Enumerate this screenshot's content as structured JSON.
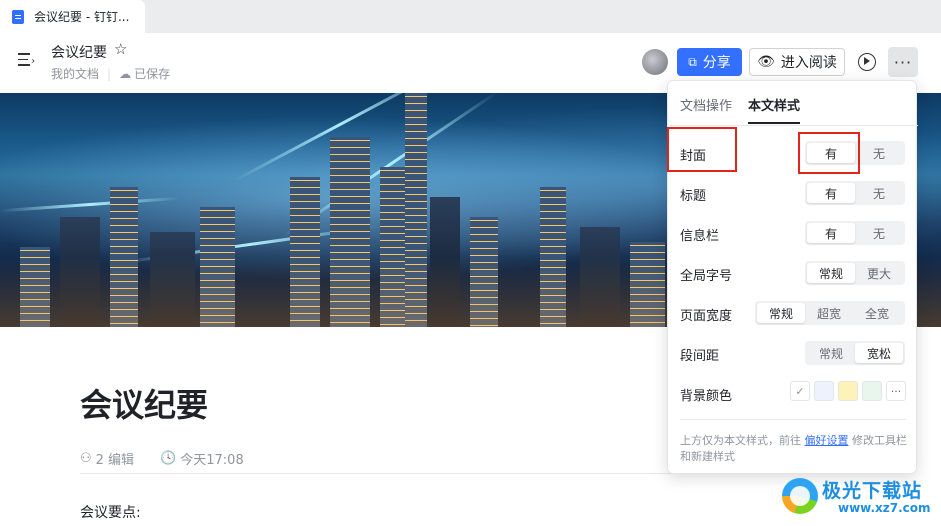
{
  "tab": {
    "title": "会议纪要 - 钉钉..."
  },
  "header": {
    "doc_title": "会议纪要",
    "location": "我的文档",
    "save_status": "已保存",
    "share_label": "分享",
    "read_label": "进入阅读",
    "more_label": "···"
  },
  "document": {
    "heading": "会议纪要",
    "editors": "2 编辑",
    "updated": "今天17:08",
    "first_line": "会议要点:"
  },
  "style_panel": {
    "tabs": [
      "文档操作",
      "本文样式"
    ],
    "active_tab": "本文样式",
    "rows": [
      {
        "label": "封面",
        "options": [
          "有",
          "无"
        ],
        "selected": "有"
      },
      {
        "label": "标题",
        "options": [
          "有",
          "无"
        ],
        "selected": "有"
      },
      {
        "label": "信息栏",
        "options": [
          "有",
          "无"
        ],
        "selected": "有"
      },
      {
        "label": "全局字号",
        "options": [
          "常规",
          "更大"
        ],
        "selected": "常规"
      },
      {
        "label": "页面宽度",
        "options": [
          "常规",
          "超宽",
          "全宽"
        ],
        "selected": "常规"
      },
      {
        "label": "段间距",
        "options": [
          "常规",
          "宽松"
        ],
        "selected": "宽松"
      }
    ],
    "bg_color_label": "背景颜色",
    "bg_colors": [
      "#ffffff",
      "#eef2fc",
      "#fdf3b8",
      "#e8f6ee"
    ],
    "footer_pre": "上方仅为本文样式，前往",
    "footer_link": "偏好设置",
    "footer_post": "修改工具栏和新建样式"
  },
  "watermark": {
    "name": "极光下载站",
    "url": "www.xz7.com"
  },
  "colors": {
    "accent": "#3370ff",
    "highlight": "#e1251b"
  }
}
